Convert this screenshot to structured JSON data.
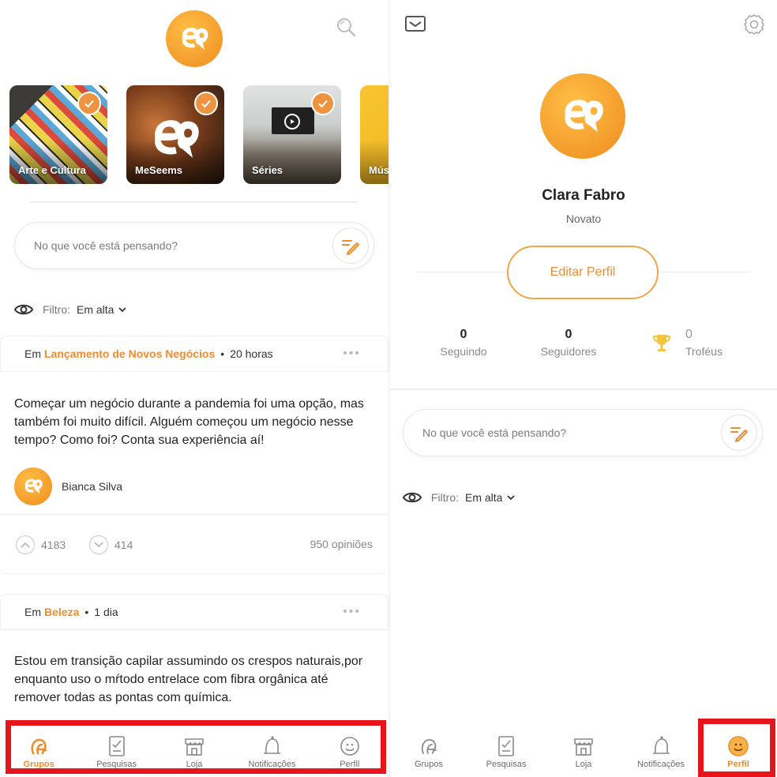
{
  "left": {
    "groups": [
      {
        "label": "Arte e Cultura",
        "checked": true
      },
      {
        "label": "MeSeems",
        "checked": true
      },
      {
        "label": "Séries",
        "checked": true
      },
      {
        "label": "Mús",
        "checked": false
      }
    ],
    "composer_placeholder": "No que você está pensando?",
    "filter": {
      "label": "Filtro:",
      "value": "Em alta"
    },
    "posts": [
      {
        "prefix": "Em",
        "group": "Lançamento de Novos Negócios",
        "time": "20 horas",
        "text": "Começar um negócio durante a pandemia foi uma opção, mas também foi muito difícil. Alguém começou um negócio nesse tempo? Como foi? Conta sua experiência aí!",
        "author": "Bianca Silva",
        "upvotes": "4183",
        "downvotes": "414",
        "opinions": "950 opiniões"
      },
      {
        "prefix": "Em",
        "group": "Beleza",
        "time": "1 dia",
        "text": "Estou em transição capilar assumindo os crespos naturais,por enquanto uso o mŕtodo entrelace com fibra orgânica até remover todas as pontas com química."
      }
    ],
    "tabs": [
      {
        "label": "Grupos",
        "icon": "groups-icon",
        "active": true
      },
      {
        "label": "Pesquisas",
        "icon": "surveys-icon",
        "active": false
      },
      {
        "label": "Loja",
        "icon": "store-icon",
        "active": false
      },
      {
        "label": "Notificações",
        "icon": "bell-icon",
        "active": false
      },
      {
        "label": "Perfil",
        "icon": "profile-icon",
        "active": false
      }
    ]
  },
  "right": {
    "profile": {
      "name": "Clara Fabro",
      "level": "Novato",
      "edit_label": "Editar Perfil"
    },
    "stats": {
      "following": {
        "value": "0",
        "label": "Seguindo"
      },
      "followers": {
        "value": "0",
        "label": "Seguidores"
      },
      "trophies": {
        "value": "0",
        "label": "Troféus"
      }
    },
    "composer_placeholder": "No que você está pensando?",
    "filter": {
      "label": "Filtro:",
      "value": "Em alta"
    },
    "tabs": [
      {
        "label": "Grupos",
        "icon": "groups-icon",
        "active": false
      },
      {
        "label": "Pesquisas",
        "icon": "surveys-icon",
        "active": false
      },
      {
        "label": "Loja",
        "icon": "store-icon",
        "active": false
      },
      {
        "label": "Notificações",
        "icon": "bell-icon",
        "active": false
      },
      {
        "label": "Perfil",
        "icon": "profile-icon",
        "active": true
      }
    ]
  },
  "colors": {
    "accent": "#ee8c2f",
    "highlight": "#e8141c",
    "logo": "#f5a02e"
  }
}
